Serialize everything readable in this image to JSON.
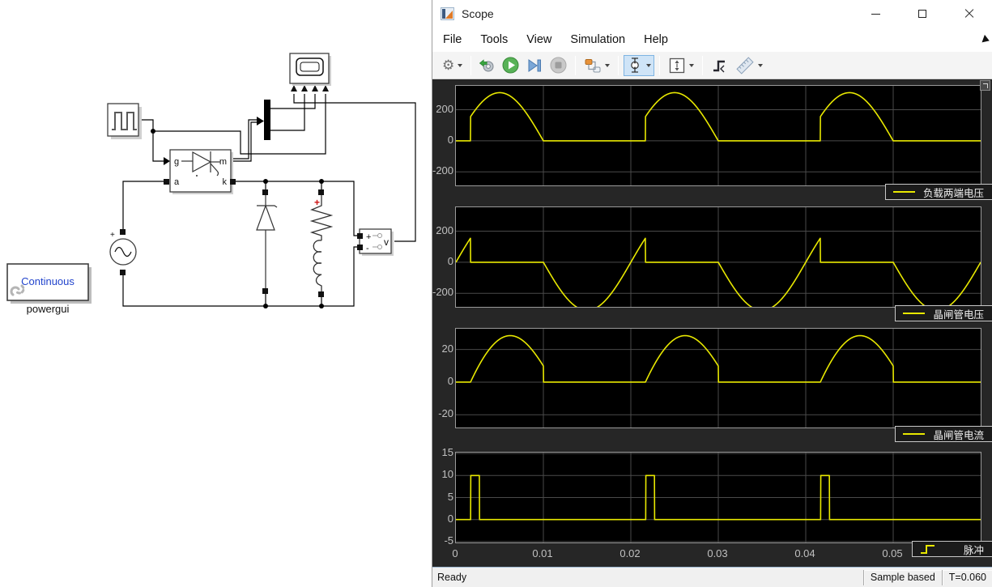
{
  "window": {
    "title": "Scope"
  },
  "menu": {
    "items": [
      "File",
      "Tools",
      "View",
      "Simulation",
      "Help"
    ]
  },
  "toolbar": {
    "buttons": [
      "settings-gear",
      "highlight-model",
      "run",
      "step-forward",
      "stop",
      "signal-config",
      "scale-y-axis",
      "fit-to-view",
      "trigger",
      "measurements"
    ]
  },
  "statusbar": {
    "left": "Ready",
    "mode": "Sample based",
    "time": "T=0.060"
  },
  "colors": {
    "trace": "#e8e800",
    "figure_bg": "#262626",
    "axes_bg": "#000000",
    "grid": "#4a4a4a",
    "tick_text": "#c0c0c0",
    "selected_tool_bg": "#cfe4f7"
  },
  "diagram": {
    "powergui": {
      "text": "Continuous",
      "label": "powergui"
    },
    "thyristor_ports": {
      "g": "g",
      "a": "a",
      "m": "m",
      "k": "k"
    },
    "voltmeter": {
      "plus": "+",
      "minus": "-",
      "label": "v"
    },
    "ac_source": {
      "plus": "+"
    },
    "rlc_branch": {
      "plus": "+"
    }
  },
  "chart_data": [
    {
      "type": "line",
      "legend": "负载两端电压",
      "xlim": [
        0,
        0.06
      ],
      "ylim": [
        -287,
        354
      ],
      "yticks": [
        200,
        0,
        -200
      ],
      "grid": true,
      "legend_position": "bottom-right",
      "signal": {
        "kind": "load_voltage",
        "amplitude": 310,
        "frequency": 50,
        "fire_time": 0.00167,
        "period": 0.02,
        "peak": 310
      }
    },
    {
      "type": "line",
      "legend": "晶闸管电压",
      "xlim": [
        0,
        0.06
      ],
      "ylim": [
        -287,
        354
      ],
      "yticks": [
        200,
        0,
        -200
      ],
      "grid": true,
      "legend_position": "bottom-right",
      "signal": {
        "kind": "thyristor_voltage",
        "amplitude": 310,
        "frequency": 50,
        "fire_time": 0.00167,
        "period": 0.02,
        "value_at_fire": 155,
        "min": -310
      }
    },
    {
      "type": "line",
      "legend": "晶闸管电流",
      "xlim": [
        0,
        0.06
      ],
      "ylim": [
        -27.8,
        32.7
      ],
      "yticks": [
        20,
        0,
        -20
      ],
      "grid": true,
      "legend_position": "bottom-right",
      "signal": {
        "kind": "thyristor_current",
        "peak": 29,
        "frequency": 50,
        "fire_time": 0.00167,
        "period": 0.02,
        "phase_lag": 0.35,
        "tau": 0.002,
        "turnoff_time": 0.01,
        "value_at_turnoff": 9.9
      }
    },
    {
      "type": "line",
      "legend": "脉冲",
      "xlim": [
        0,
        0.06
      ],
      "ylim": [
        -5.2,
        15.2
      ],
      "yticks": [
        15,
        10,
        5,
        0,
        -5
      ],
      "xticks": [
        0,
        0.01,
        0.02,
        0.03,
        0.04,
        0.05
      ],
      "xtick_labels": [
        "0",
        "0.01",
        "0.02",
        "0.03",
        "0.04",
        "0.05"
      ],
      "grid": true,
      "legend_position": "bottom-right",
      "signal": {
        "kind": "pulse_train",
        "amplitude": 10,
        "fire_time": 0.0017,
        "pulse_width": 0.001,
        "period": 0.02
      }
    }
  ]
}
